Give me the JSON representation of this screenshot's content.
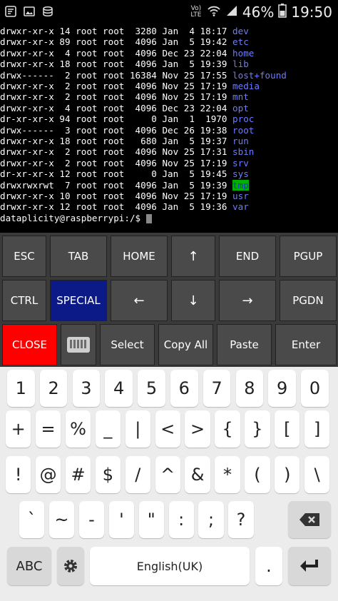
{
  "status_bar": {
    "signal_label": "Vo) LTE",
    "battery": "46%",
    "time": "19:50",
    "icons": [
      "notification-icon",
      "image-icon",
      "storage-icon",
      "wifi-icon",
      "signal-icon",
      "battery-icon"
    ]
  },
  "terminal": {
    "rows": [
      {
        "meta": "drwxr-xr-x 14 root root  3280 Jan  4 18:17 ",
        "name": "dev",
        "highlight": false
      },
      {
        "meta": "drwxr-xr-x 89 root root  4096 Jan  5 19:42 ",
        "name": "etc",
        "highlight": false
      },
      {
        "meta": "drwxr-xr-x  4 root root  4096 Dec 23 22:04 ",
        "name": "home",
        "highlight": false
      },
      {
        "meta": "drwxr-xr-x 18 root root  4096 Jan  5 19:39 ",
        "name": "lib",
        "highlight": false
      },
      {
        "meta": "drwx------  2 root root 16384 Nov 25 17:55 ",
        "name": "lost+found",
        "highlight": false
      },
      {
        "meta": "drwxr-xr-x  2 root root  4096 Nov 25 17:19 ",
        "name": "media",
        "highlight": false
      },
      {
        "meta": "drwxr-xr-x  2 root root  4096 Nov 25 17:19 ",
        "name": "mnt",
        "highlight": false
      },
      {
        "meta": "drwxr-xr-x  4 root root  4096 Dec 23 22:04 ",
        "name": "opt",
        "highlight": false
      },
      {
        "meta": "dr-xr-xr-x 94 root root     0 Jan  1  1970 ",
        "name": "proc",
        "highlight": false
      },
      {
        "meta": "drwx------  3 root root  4096 Dec 26 19:38 ",
        "name": "root",
        "highlight": false
      },
      {
        "meta": "drwxr-xr-x 18 root root   680 Jan  5 19:37 ",
        "name": "run",
        "highlight": false
      },
      {
        "meta": "drwxr-xr-x  2 root root  4096 Nov 25 17:31 ",
        "name": "sbin",
        "highlight": false
      },
      {
        "meta": "drwxr-xr-x  2 root root  4096 Nov 25 17:19 ",
        "name": "srv",
        "highlight": false
      },
      {
        "meta": "dr-xr-xr-x 12 root root     0 Jan  5 19:45 ",
        "name": "sys",
        "highlight": false
      },
      {
        "meta": "drwxrwxrwt  7 root root  4096 Jan  5 19:39 ",
        "name": "tmp",
        "highlight": true
      },
      {
        "meta": "drwxr-xr-x 10 root root  4096 Nov 25 17:19 ",
        "name": "usr",
        "highlight": false
      },
      {
        "meta": "drwxr-xr-x 12 root root  4096 Jan  5 19:36 ",
        "name": "var",
        "highlight": false
      }
    ],
    "prompt": "dataplicity@raspberrypi:/$ "
  },
  "keys": {
    "esc": "ESC",
    "tab": "TAB",
    "home": "HOME",
    "up": "↑",
    "end": "END",
    "pgup": "PGUP",
    "ctrl": "CTRL",
    "special": "SPECIAL",
    "left": "←",
    "down": "↓",
    "right": "→",
    "pgdn": "PGDN",
    "close": "CLOSE",
    "select": "Select",
    "copy_all": "Copy All",
    "paste": "Paste",
    "enter": "Enter"
  },
  "keyboard": {
    "row1": [
      "1",
      "2",
      "3",
      "4",
      "5",
      "6",
      "7",
      "8",
      "9",
      "0"
    ],
    "row2": [
      "+",
      "=",
      "%",
      "_",
      "|",
      "<",
      ">",
      "{",
      "}",
      "[",
      "]"
    ],
    "row3": [
      "!",
      "@",
      "#",
      "$",
      "/",
      "^",
      "&",
      "*",
      "(",
      ")",
      "\\"
    ],
    "row4": [
      "`",
      "~",
      "-",
      "'",
      "\"",
      ":",
      ";",
      "?"
    ],
    "abc": "ABC",
    "space": "English(UK)",
    "period": "."
  },
  "colors": {
    "special_key": "#0b1a86",
    "close_key": "#ff0000",
    "dir_name": "#6b7cff",
    "highlight_bg": "#00b000"
  }
}
